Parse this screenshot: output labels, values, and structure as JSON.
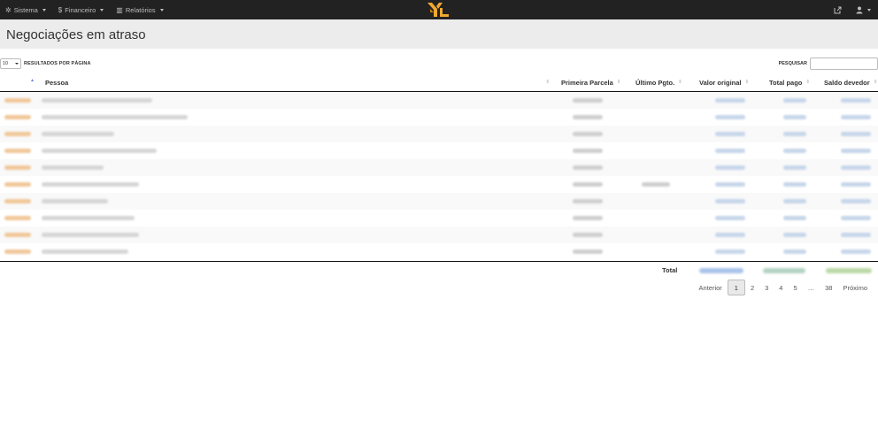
{
  "navbar": {
    "menu": [
      {
        "icon": "gear-icon",
        "glyph": "✲",
        "label": "Sistema"
      },
      {
        "icon": "dollar-icon",
        "glyph": "$",
        "label": "Financeiro"
      },
      {
        "icon": "chart-icon",
        "glyph": "▥",
        "label": "Relatórios"
      }
    ],
    "brand_color": "#f0a830",
    "right_icons": [
      {
        "icon": "external-link-icon",
        "glyph": "⇱"
      },
      {
        "icon": "user-menu-icon",
        "glyph": "👤"
      }
    ]
  },
  "page": {
    "title": "Negociações em atraso"
  },
  "controls": {
    "page_length": "10",
    "page_length_label": "RESULTADOS POR PÁGINA",
    "search_label": "PESQUISAR",
    "search_value": ""
  },
  "table": {
    "columns": [
      "Pessoa",
      "Primeira Parcela",
      "Último Pgto.",
      "Valor original",
      "Total pago",
      "Saldo devedor"
    ],
    "sort_indicator": "▲",
    "sort_both": "⇕",
    "row_count": 10,
    "total_label": "Total"
  },
  "pagination": {
    "previous": "Anterior",
    "pages": [
      "1",
      "2",
      "3",
      "4",
      "5"
    ],
    "current": "1",
    "ellipsis": "…",
    "last": "38",
    "next": "Próximo"
  }
}
